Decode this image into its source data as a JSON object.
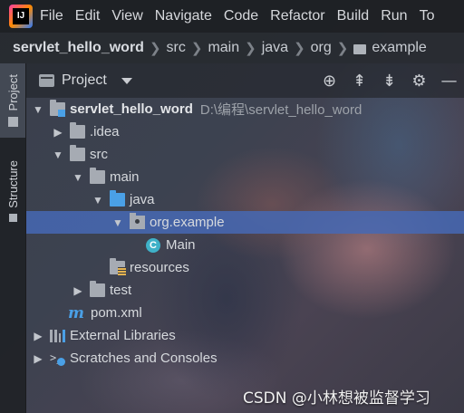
{
  "menubar": {
    "logo_text": "IJ",
    "items": [
      "File",
      "Edit",
      "View",
      "Navigate",
      "Code",
      "Refactor",
      "Build",
      "Run",
      "To"
    ]
  },
  "breadcrumb": [
    "servlet_hello_word",
    "src",
    "main",
    "java",
    "org",
    "example"
  ],
  "side_stripe": {
    "project": "Project",
    "structure": "Structure"
  },
  "panel": {
    "title": "Project",
    "tools": [
      "target-icon",
      "expand-all-icon",
      "collapse-all-icon",
      "gear-icon",
      "minimize-icon"
    ]
  },
  "tree": [
    {
      "label": "servlet_hello_word",
      "path": "D:\\编程\\servlet_hello_word",
      "arrow": "down",
      "icon": "module-folder-icon"
    },
    {
      "label": ".idea",
      "arrow": "right",
      "icon": "folder-icon"
    },
    {
      "label": "src",
      "arrow": "down",
      "icon": "folder-icon"
    },
    {
      "label": "main",
      "arrow": "down",
      "icon": "folder-icon"
    },
    {
      "label": "java",
      "arrow": "down",
      "icon": "source-folder-icon"
    },
    {
      "label": "org.example",
      "arrow": "down",
      "icon": "package-icon",
      "selected": true
    },
    {
      "label": "Main",
      "icon": "java-class-icon"
    },
    {
      "label": "resources",
      "icon": "resources-folder-icon"
    },
    {
      "label": "test",
      "arrow": "right",
      "icon": "folder-icon"
    },
    {
      "label": "pom.xml",
      "icon": "maven-icon"
    },
    {
      "label": "External Libraries",
      "arrow": "right",
      "icon": "libraries-icon"
    },
    {
      "label": "Scratches and Consoles",
      "arrow": "right",
      "icon": "scratches-icon"
    }
  ],
  "watermark": "CSDN @小林想被监督学习",
  "colors": {
    "selection": "#4669b4",
    "accent_blue": "#4aa0e6",
    "class_icon": "#3fb1c8"
  }
}
